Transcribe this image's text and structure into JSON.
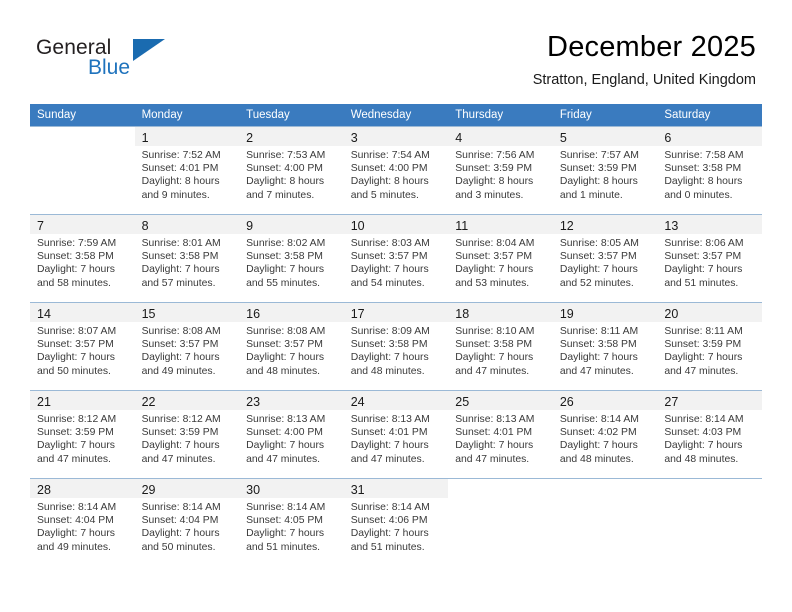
{
  "brand": {
    "name_part1": "General",
    "name_part2": "Blue",
    "accent_color": "#1a6bb0",
    "logo_icon": "triangle-flag-icon"
  },
  "header": {
    "title": "December 2025",
    "location": "Stratton, England, United Kingdom"
  },
  "calendar": {
    "header_color": "#3a7bbf",
    "weekday_headers": [
      "Sunday",
      "Monday",
      "Tuesday",
      "Wednesday",
      "Thursday",
      "Friday",
      "Saturday"
    ],
    "weeks": [
      [
        {
          "day": "",
          "sunrise": "",
          "sunset": "",
          "daylight_line1": "",
          "daylight_line2": ""
        },
        {
          "day": "1",
          "sunrise": "Sunrise: 7:52 AM",
          "sunset": "Sunset: 4:01 PM",
          "daylight_line1": "Daylight: 8 hours",
          "daylight_line2": "and 9 minutes."
        },
        {
          "day": "2",
          "sunrise": "Sunrise: 7:53 AM",
          "sunset": "Sunset: 4:00 PM",
          "daylight_line1": "Daylight: 8 hours",
          "daylight_line2": "and 7 minutes."
        },
        {
          "day": "3",
          "sunrise": "Sunrise: 7:54 AM",
          "sunset": "Sunset: 4:00 PM",
          "daylight_line1": "Daylight: 8 hours",
          "daylight_line2": "and 5 minutes."
        },
        {
          "day": "4",
          "sunrise": "Sunrise: 7:56 AM",
          "sunset": "Sunset: 3:59 PM",
          "daylight_line1": "Daylight: 8 hours",
          "daylight_line2": "and 3 minutes."
        },
        {
          "day": "5",
          "sunrise": "Sunrise: 7:57 AM",
          "sunset": "Sunset: 3:59 PM",
          "daylight_line1": "Daylight: 8 hours",
          "daylight_line2": "and 1 minute."
        },
        {
          "day": "6",
          "sunrise": "Sunrise: 7:58 AM",
          "sunset": "Sunset: 3:58 PM",
          "daylight_line1": "Daylight: 8 hours",
          "daylight_line2": "and 0 minutes."
        }
      ],
      [
        {
          "day": "7",
          "sunrise": "Sunrise: 7:59 AM",
          "sunset": "Sunset: 3:58 PM",
          "daylight_line1": "Daylight: 7 hours",
          "daylight_line2": "and 58 minutes."
        },
        {
          "day": "8",
          "sunrise": "Sunrise: 8:01 AM",
          "sunset": "Sunset: 3:58 PM",
          "daylight_line1": "Daylight: 7 hours",
          "daylight_line2": "and 57 minutes."
        },
        {
          "day": "9",
          "sunrise": "Sunrise: 8:02 AM",
          "sunset": "Sunset: 3:58 PM",
          "daylight_line1": "Daylight: 7 hours",
          "daylight_line2": "and 55 minutes."
        },
        {
          "day": "10",
          "sunrise": "Sunrise: 8:03 AM",
          "sunset": "Sunset: 3:57 PM",
          "daylight_line1": "Daylight: 7 hours",
          "daylight_line2": "and 54 minutes."
        },
        {
          "day": "11",
          "sunrise": "Sunrise: 8:04 AM",
          "sunset": "Sunset: 3:57 PM",
          "daylight_line1": "Daylight: 7 hours",
          "daylight_line2": "and 53 minutes."
        },
        {
          "day": "12",
          "sunrise": "Sunrise: 8:05 AM",
          "sunset": "Sunset: 3:57 PM",
          "daylight_line1": "Daylight: 7 hours",
          "daylight_line2": "and 52 minutes."
        },
        {
          "day": "13",
          "sunrise": "Sunrise: 8:06 AM",
          "sunset": "Sunset: 3:57 PM",
          "daylight_line1": "Daylight: 7 hours",
          "daylight_line2": "and 51 minutes."
        }
      ],
      [
        {
          "day": "14",
          "sunrise": "Sunrise: 8:07 AM",
          "sunset": "Sunset: 3:57 PM",
          "daylight_line1": "Daylight: 7 hours",
          "daylight_line2": "and 50 minutes."
        },
        {
          "day": "15",
          "sunrise": "Sunrise: 8:08 AM",
          "sunset": "Sunset: 3:57 PM",
          "daylight_line1": "Daylight: 7 hours",
          "daylight_line2": "and 49 minutes."
        },
        {
          "day": "16",
          "sunrise": "Sunrise: 8:08 AM",
          "sunset": "Sunset: 3:57 PM",
          "daylight_line1": "Daylight: 7 hours",
          "daylight_line2": "and 48 minutes."
        },
        {
          "day": "17",
          "sunrise": "Sunrise: 8:09 AM",
          "sunset": "Sunset: 3:58 PM",
          "daylight_line1": "Daylight: 7 hours",
          "daylight_line2": "and 48 minutes."
        },
        {
          "day": "18",
          "sunrise": "Sunrise: 8:10 AM",
          "sunset": "Sunset: 3:58 PM",
          "daylight_line1": "Daylight: 7 hours",
          "daylight_line2": "and 47 minutes."
        },
        {
          "day": "19",
          "sunrise": "Sunrise: 8:11 AM",
          "sunset": "Sunset: 3:58 PM",
          "daylight_line1": "Daylight: 7 hours",
          "daylight_line2": "and 47 minutes."
        },
        {
          "day": "20",
          "sunrise": "Sunrise: 8:11 AM",
          "sunset": "Sunset: 3:59 PM",
          "daylight_line1": "Daylight: 7 hours",
          "daylight_line2": "and 47 minutes."
        }
      ],
      [
        {
          "day": "21",
          "sunrise": "Sunrise: 8:12 AM",
          "sunset": "Sunset: 3:59 PM",
          "daylight_line1": "Daylight: 7 hours",
          "daylight_line2": "and 47 minutes."
        },
        {
          "day": "22",
          "sunrise": "Sunrise: 8:12 AM",
          "sunset": "Sunset: 3:59 PM",
          "daylight_line1": "Daylight: 7 hours",
          "daylight_line2": "and 47 minutes."
        },
        {
          "day": "23",
          "sunrise": "Sunrise: 8:13 AM",
          "sunset": "Sunset: 4:00 PM",
          "daylight_line1": "Daylight: 7 hours",
          "daylight_line2": "and 47 minutes."
        },
        {
          "day": "24",
          "sunrise": "Sunrise: 8:13 AM",
          "sunset": "Sunset: 4:01 PM",
          "daylight_line1": "Daylight: 7 hours",
          "daylight_line2": "and 47 minutes."
        },
        {
          "day": "25",
          "sunrise": "Sunrise: 8:13 AM",
          "sunset": "Sunset: 4:01 PM",
          "daylight_line1": "Daylight: 7 hours",
          "daylight_line2": "and 47 minutes."
        },
        {
          "day": "26",
          "sunrise": "Sunrise: 8:14 AM",
          "sunset": "Sunset: 4:02 PM",
          "daylight_line1": "Daylight: 7 hours",
          "daylight_line2": "and 48 minutes."
        },
        {
          "day": "27",
          "sunrise": "Sunrise: 8:14 AM",
          "sunset": "Sunset: 4:03 PM",
          "daylight_line1": "Daylight: 7 hours",
          "daylight_line2": "and 48 minutes."
        }
      ],
      [
        {
          "day": "28",
          "sunrise": "Sunrise: 8:14 AM",
          "sunset": "Sunset: 4:04 PM",
          "daylight_line1": "Daylight: 7 hours",
          "daylight_line2": "and 49 minutes."
        },
        {
          "day": "29",
          "sunrise": "Sunrise: 8:14 AM",
          "sunset": "Sunset: 4:04 PM",
          "daylight_line1": "Daylight: 7 hours",
          "daylight_line2": "and 50 minutes."
        },
        {
          "day": "30",
          "sunrise": "Sunrise: 8:14 AM",
          "sunset": "Sunset: 4:05 PM",
          "daylight_line1": "Daylight: 7 hours",
          "daylight_line2": "and 51 minutes."
        },
        {
          "day": "31",
          "sunrise": "Sunrise: 8:14 AM",
          "sunset": "Sunset: 4:06 PM",
          "daylight_line1": "Daylight: 7 hours",
          "daylight_line2": "and 51 minutes."
        },
        {
          "day": "",
          "sunrise": "",
          "sunset": "",
          "daylight_line1": "",
          "daylight_line2": ""
        },
        {
          "day": "",
          "sunrise": "",
          "sunset": "",
          "daylight_line1": "",
          "daylight_line2": ""
        },
        {
          "day": "",
          "sunrise": "",
          "sunset": "",
          "daylight_line1": "",
          "daylight_line2": ""
        }
      ]
    ]
  }
}
